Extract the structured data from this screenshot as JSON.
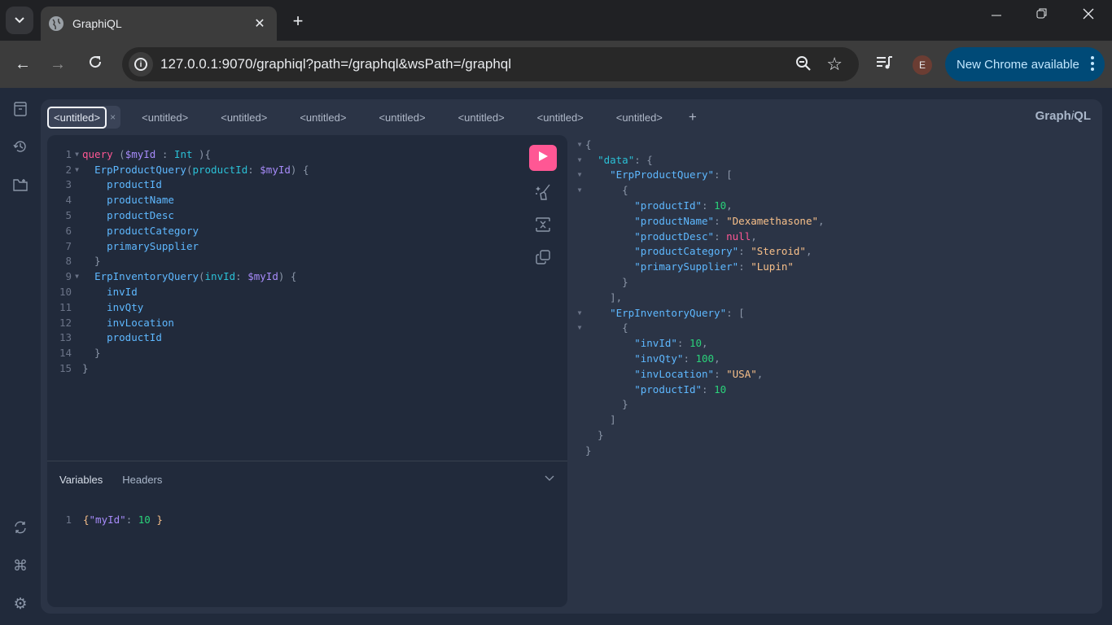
{
  "browser": {
    "tab_title": "GraphiQL",
    "url": "127.0.0.1:9070/graphiql?path=/graphql&wsPath=/graphql",
    "profile_initial": "E",
    "update_label": "New Chrome available",
    "icons": {
      "tab_search": "chevron-down-icon",
      "favicon": "globe-icon",
      "close_tab": "close-icon",
      "new_tab": "plus-icon",
      "minimize": "minimize-icon",
      "restore": "restore-icon",
      "close_window": "close-icon",
      "back": "arrow-left-icon",
      "forward": "arrow-right-icon",
      "reload": "reload-icon",
      "site_info": "info-icon",
      "zoom": "zoom-out-icon",
      "bookmark": "star-icon",
      "media": "media-control-icon",
      "menu": "more-vertical-icon"
    }
  },
  "graphiql": {
    "brand_prefix": "Graph",
    "brand_italic": "i",
    "brand_suffix": "QL",
    "tabs": [
      {
        "label": "<untitled>",
        "active": true
      },
      {
        "label": "<untitled>"
      },
      {
        "label": "<untitled>"
      },
      {
        "label": "<untitled>"
      },
      {
        "label": "<untitled>"
      },
      {
        "label": "<untitled>"
      },
      {
        "label": "<untitled>"
      },
      {
        "label": "<untitled>"
      }
    ],
    "add_tab": "+",
    "close_tab": "×",
    "sidebar_icons_top": [
      "documentation-icon",
      "history-icon",
      "explorer-icon"
    ],
    "sidebar_icons_bottom": [
      "refetch-schema-icon",
      "shortcuts-icon",
      "settings-icon"
    ],
    "toolbar_icons": [
      "play-icon",
      "prettify-icon",
      "merge-fragments-icon",
      "copy-icon"
    ],
    "query_lines": [
      {
        "n": "1",
        "fold": true,
        "tokens": [
          [
            "kw",
            "query"
          ],
          [
            "p",
            " ("
          ],
          [
            "var",
            "$myId"
          ],
          [
            "p",
            " : "
          ],
          [
            "type",
            "Int"
          ],
          [
            "p",
            " ){"
          ]
        ]
      },
      {
        "n": "2",
        "fold": true,
        "tokens": [
          [
            "p",
            "  "
          ],
          [
            "field",
            "ErpProductQuery"
          ],
          [
            "p",
            "("
          ],
          [
            "arg",
            "productId"
          ],
          [
            "p",
            ": "
          ],
          [
            "var",
            "$myId"
          ],
          [
            "p",
            ") {"
          ]
        ]
      },
      {
        "n": "3",
        "tokens": [
          [
            "p",
            "    "
          ],
          [
            "field",
            "productId"
          ]
        ]
      },
      {
        "n": "4",
        "tokens": [
          [
            "p",
            "    "
          ],
          [
            "field",
            "productName"
          ]
        ]
      },
      {
        "n": "5",
        "tokens": [
          [
            "p",
            "    "
          ],
          [
            "field",
            "productDesc"
          ]
        ]
      },
      {
        "n": "6",
        "tokens": [
          [
            "p",
            "    "
          ],
          [
            "field",
            "productCategory"
          ]
        ]
      },
      {
        "n": "7",
        "tokens": [
          [
            "p",
            "    "
          ],
          [
            "field",
            "primarySupplier"
          ]
        ]
      },
      {
        "n": "8",
        "tokens": [
          [
            "p",
            "  }"
          ]
        ]
      },
      {
        "n": "9",
        "fold": true,
        "tokens": [
          [
            "p",
            "  "
          ],
          [
            "field",
            "ErpInventoryQuery"
          ],
          [
            "p",
            "("
          ],
          [
            "arg",
            "invId"
          ],
          [
            "p",
            ": "
          ],
          [
            "var",
            "$myId"
          ],
          [
            "p",
            ") {"
          ]
        ]
      },
      {
        "n": "10",
        "tokens": [
          [
            "p",
            "    "
          ],
          [
            "field",
            "invId"
          ]
        ]
      },
      {
        "n": "11",
        "tokens": [
          [
            "p",
            "    "
          ],
          [
            "field",
            "invQty"
          ]
        ]
      },
      {
        "n": "12",
        "tokens": [
          [
            "p",
            "    "
          ],
          [
            "field",
            "invLocation"
          ]
        ]
      },
      {
        "n": "13",
        "tokens": [
          [
            "p",
            "    "
          ],
          [
            "field",
            "productId"
          ]
        ]
      },
      {
        "n": "14",
        "tokens": [
          [
            "p",
            "  }"
          ]
        ]
      },
      {
        "n": "15",
        "tokens": [
          [
            "p",
            "}"
          ]
        ]
      }
    ],
    "variables_tab": "Variables",
    "headers_tab": "Headers",
    "variables_lines": [
      {
        "n": "1",
        "tokens": [
          [
            "str",
            "{"
          ],
          [
            "var",
            "\"myId\""
          ],
          [
            "p",
            ": "
          ],
          [
            "num",
            "10"
          ],
          [
            "p",
            " "
          ],
          [
            "str",
            "}"
          ]
        ]
      }
    ],
    "result_lines": [
      {
        "fold": true,
        "tokens": [
          [
            "p",
            "{"
          ]
        ]
      },
      {
        "fold": true,
        "tokens": [
          [
            "p",
            "  "
          ],
          [
            "keyc",
            "\"data\""
          ],
          [
            "p",
            ": {"
          ]
        ]
      },
      {
        "fold": true,
        "tokens": [
          [
            "p",
            "    "
          ],
          [
            "key",
            "\"ErpProductQuery\""
          ],
          [
            "p",
            ": ["
          ]
        ]
      },
      {
        "fold": true,
        "tokens": [
          [
            "p",
            "      {"
          ]
        ]
      },
      {
        "tokens": [
          [
            "p",
            "        "
          ],
          [
            "key",
            "\"productId\""
          ],
          [
            "p",
            ": "
          ],
          [
            "num",
            "10"
          ],
          [
            "p",
            ","
          ]
        ]
      },
      {
        "tokens": [
          [
            "p",
            "        "
          ],
          [
            "key",
            "\"productName\""
          ],
          [
            "p",
            ": "
          ],
          [
            "str",
            "\"Dexamethasone\""
          ],
          [
            "p",
            ","
          ]
        ]
      },
      {
        "tokens": [
          [
            "p",
            "        "
          ],
          [
            "key",
            "\"productDesc\""
          ],
          [
            "p",
            ": "
          ],
          [
            "null",
            "null"
          ],
          [
            "p",
            ","
          ]
        ]
      },
      {
        "tokens": [
          [
            "p",
            "        "
          ],
          [
            "key",
            "\"productCategory\""
          ],
          [
            "p",
            ": "
          ],
          [
            "str",
            "\"Steroid\""
          ],
          [
            "p",
            ","
          ]
        ]
      },
      {
        "tokens": [
          [
            "p",
            "        "
          ],
          [
            "key",
            "\"primarySupplier\""
          ],
          [
            "p",
            ": "
          ],
          [
            "str",
            "\"Lupin\""
          ]
        ]
      },
      {
        "tokens": [
          [
            "p",
            "      }"
          ]
        ]
      },
      {
        "tokens": [
          [
            "p",
            "    ],"
          ]
        ]
      },
      {
        "fold": true,
        "tokens": [
          [
            "p",
            "    "
          ],
          [
            "key",
            "\"ErpInventoryQuery\""
          ],
          [
            "p",
            ": ["
          ]
        ]
      },
      {
        "fold": true,
        "tokens": [
          [
            "p",
            "      {"
          ]
        ]
      },
      {
        "tokens": [
          [
            "p",
            "        "
          ],
          [
            "key",
            "\"invId\""
          ],
          [
            "p",
            ": "
          ],
          [
            "num",
            "10"
          ],
          [
            "p",
            ","
          ]
        ]
      },
      {
        "tokens": [
          [
            "p",
            "        "
          ],
          [
            "key",
            "\"invQty\""
          ],
          [
            "p",
            ": "
          ],
          [
            "num",
            "100"
          ],
          [
            "p",
            ","
          ]
        ]
      },
      {
        "tokens": [
          [
            "p",
            "        "
          ],
          [
            "key",
            "\"invLocation\""
          ],
          [
            "p",
            ": "
          ],
          [
            "str",
            "\"USA\""
          ],
          [
            "p",
            ","
          ]
        ]
      },
      {
        "tokens": [
          [
            "p",
            "        "
          ],
          [
            "key",
            "\"productId\""
          ],
          [
            "p",
            ": "
          ],
          [
            "num",
            "10"
          ]
        ]
      },
      {
        "tokens": [
          [
            "p",
            "      }"
          ]
        ]
      },
      {
        "tokens": [
          [
            "p",
            "    ]"
          ]
        ]
      },
      {
        "tokens": [
          [
            "p",
            "  }"
          ]
        ]
      },
      {
        "tokens": [
          [
            "p",
            "}"
          ]
        ]
      }
    ],
    "colors": {
      "run_button": "#ff5794",
      "keyword": "#ff5794",
      "variable": "#a78bfa",
      "field": "#5eb8ff",
      "number": "#2ad27a",
      "string": "#f8c08a"
    }
  }
}
